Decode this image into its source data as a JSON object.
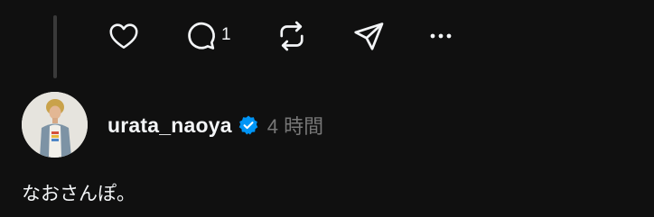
{
  "actions": {
    "like_icon": "heart-icon",
    "comment_icon": "speech-bubble-icon",
    "comment_count": "1",
    "repost_icon": "repost-icon",
    "share_icon": "paper-plane-icon",
    "more_icon": "more-dots-icon"
  },
  "post": {
    "username": "urata_naoya",
    "verified": true,
    "time": "4 時間",
    "text": "なおさんぽ。"
  },
  "colors": {
    "background": "#101010",
    "text": "#f3f5f7",
    "muted": "#777777",
    "verified_badge": "#0095f6",
    "thread_line": "#3a3a3a"
  }
}
